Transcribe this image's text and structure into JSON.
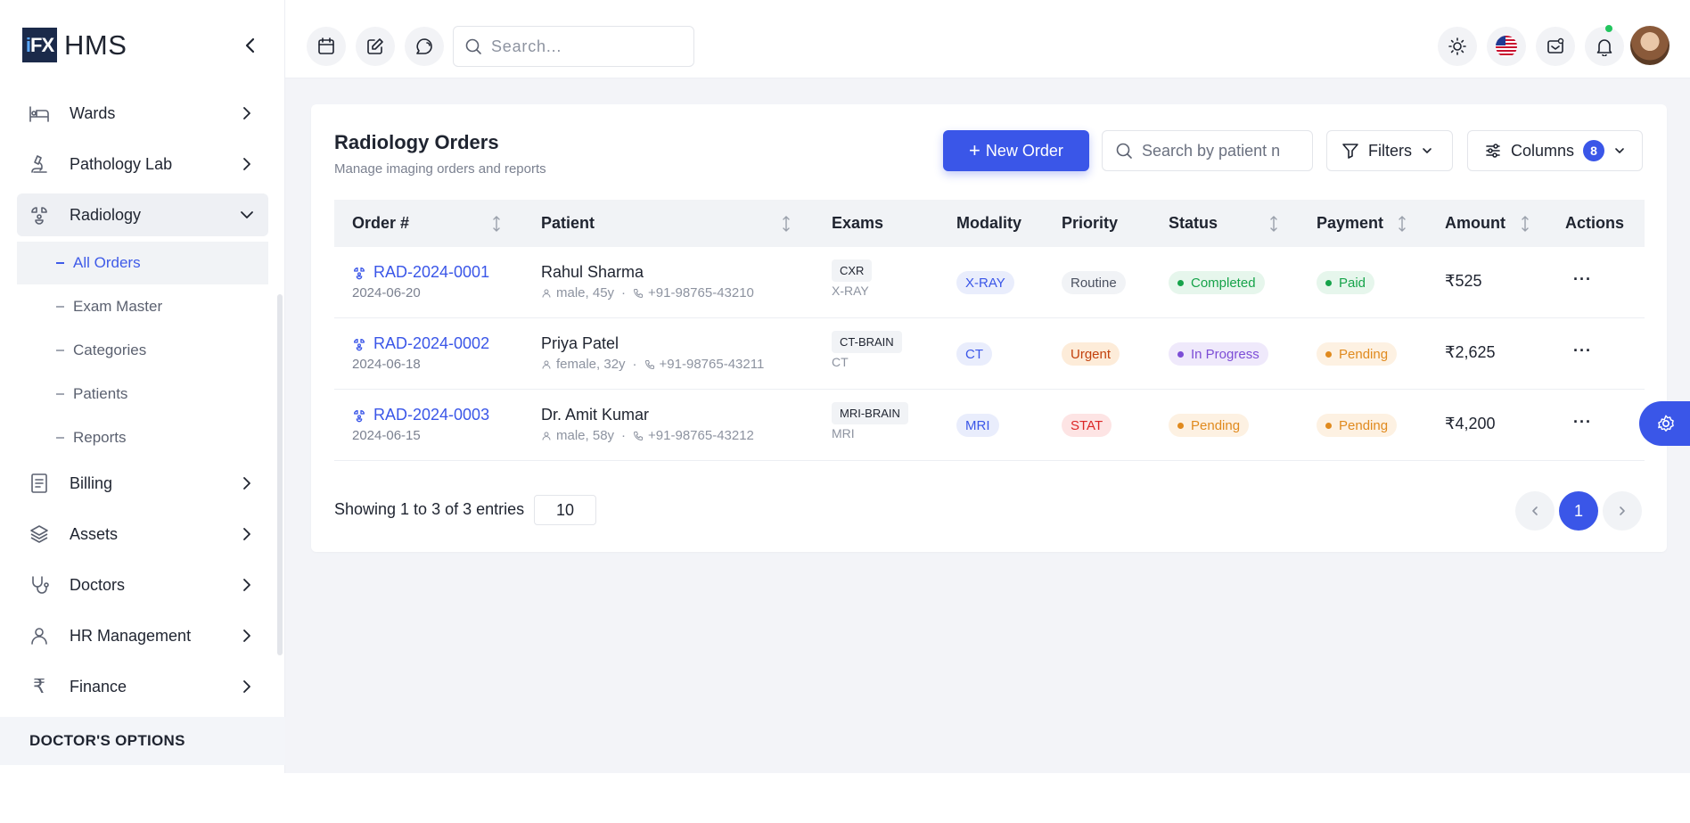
{
  "app": {
    "logo_mark": "iFX",
    "name": "HMS"
  },
  "sidebar": {
    "items": [
      {
        "label": "Wards",
        "icon": "bed-icon"
      },
      {
        "label": "Pathology Lab",
        "icon": "microscope-icon"
      },
      {
        "label": "Radiology",
        "icon": "radiology-icon",
        "expanded": true
      },
      {
        "label": "Billing",
        "icon": "invoice-icon"
      },
      {
        "label": "Assets",
        "icon": "layers-icon"
      },
      {
        "label": "Doctors",
        "icon": "stethoscope-icon"
      },
      {
        "label": "HR Management",
        "icon": "user-icon"
      },
      {
        "label": "Finance",
        "icon": "rupee-icon"
      }
    ],
    "radiology_sub": [
      {
        "label": "All Orders",
        "active": true
      },
      {
        "label": "Exam Master"
      },
      {
        "label": "Categories"
      },
      {
        "label": "Patients"
      },
      {
        "label": "Reports"
      }
    ],
    "section_title": "DOCTOR'S OPTIONS"
  },
  "topbar": {
    "search_placeholder": "Search...",
    "icons": [
      "calendar-icon",
      "edit-icon",
      "chat-icon",
      "sun-icon",
      "us-flag-icon",
      "mail-icon",
      "bell-icon"
    ]
  },
  "page": {
    "title": "Radiology Orders",
    "subtitle": "Manage imaging orders and reports",
    "new_order_label": "New Order",
    "patient_search_placeholder": "Search by patient n",
    "filters_label": "Filters",
    "columns_label": "Columns",
    "columns_count": "8"
  },
  "table": {
    "headers": [
      "Order #",
      "Patient",
      "Exams",
      "Modality",
      "Priority",
      "Status",
      "Payment",
      "Amount",
      "Actions"
    ],
    "rows": [
      {
        "order": "RAD-2024-0001",
        "date": "2024-06-20",
        "patient": "Rahul Sharma",
        "gender_age": "male, 45y",
        "phone": "+91-98765-43210",
        "exam_code": "CXR",
        "exam_modality": "X-RAY",
        "modality": "X-RAY",
        "priority": "Routine",
        "status": "Completed",
        "payment": "Paid",
        "amount": "₹525"
      },
      {
        "order": "RAD-2024-0002",
        "date": "2024-06-18",
        "patient": "Priya Patel",
        "gender_age": "female, 32y",
        "phone": "+91-98765-43211",
        "exam_code": "CT-BRAIN",
        "exam_modality": "CT",
        "modality": "CT",
        "priority": "Urgent",
        "status": "In Progress",
        "payment": "Pending",
        "amount": "₹2,625"
      },
      {
        "order": "RAD-2024-0003",
        "date": "2024-06-15",
        "patient": "Dr. Amit Kumar",
        "gender_age": "male, 58y",
        "phone": "+91-98765-43212",
        "exam_code": "MRI-BRAIN",
        "exam_modality": "MRI",
        "modality": "MRI",
        "priority": "STAT",
        "status": "Pending",
        "payment": "Pending",
        "amount": "₹4,200"
      }
    ]
  },
  "footer": {
    "showing": "Showing 1 to 3 of 3 entries",
    "page_size": "10",
    "current_page": "1"
  },
  "colors": {
    "primary": "#3a56e8",
    "completed": "#16a34a",
    "in_progress": "#7c4dd6",
    "pending": "#e08a1e",
    "urgent": "#c2410c",
    "stat": "#dc2626"
  }
}
